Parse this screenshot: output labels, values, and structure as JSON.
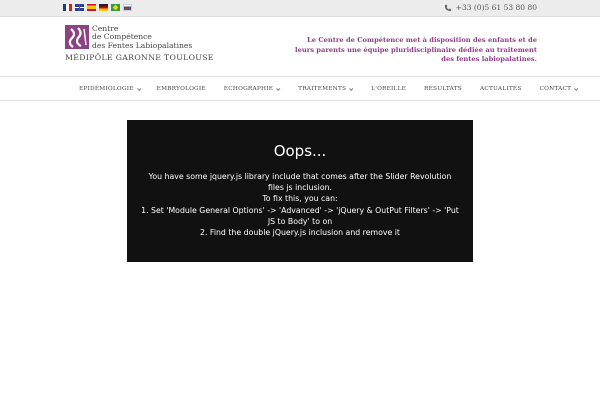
{
  "topbar": {
    "languages": [
      "fr",
      "en",
      "es",
      "de",
      "pt-br",
      "ru"
    ],
    "phone_icon": "phone-icon",
    "phone": "+33 (0)5 61 53 80 80"
  },
  "header": {
    "logo": {
      "line1": "Centre",
      "line2": "de Compétence",
      "line3": "des Fentes Labiopalatines",
      "subtitle": "MÉDIPÔLE GARONNE TOULOUSE"
    },
    "tagline": "Le Centre de Compétence met à disposition des enfants et de leurs parents une équipe pluridisciplinaire dédiée au traitement des fentes labiopalatines.",
    "accent_color": "#8f3c86"
  },
  "nav": {
    "items": [
      {
        "label": "EPIDÉMIOLOGIE",
        "has_dropdown": true
      },
      {
        "label": "EMBRYOLOGIE",
        "has_dropdown": false
      },
      {
        "label": "ECHOGRAPHIE",
        "has_dropdown": true
      },
      {
        "label": "TRAITEMENTS",
        "has_dropdown": true
      },
      {
        "label": "L'OREILLE",
        "has_dropdown": false
      },
      {
        "label": "RÉSULTATS",
        "has_dropdown": false
      },
      {
        "label": "ACTUALITÉS",
        "has_dropdown": false
      },
      {
        "label": "CONTACT",
        "has_dropdown": true
      }
    ]
  },
  "error": {
    "title": "Oops...",
    "lines": [
      "You have some jquery.js library include that comes after the Slider Revolution files js inclusion.",
      "To fix this, you can:",
      "1. Set 'Module General Options' -> 'Advanced' -> 'jQuery & OutPut Filters' -> 'Put JS to Body' to on",
      "2. Find the double jQuery.js inclusion and remove it"
    ],
    "background": "#111111"
  }
}
